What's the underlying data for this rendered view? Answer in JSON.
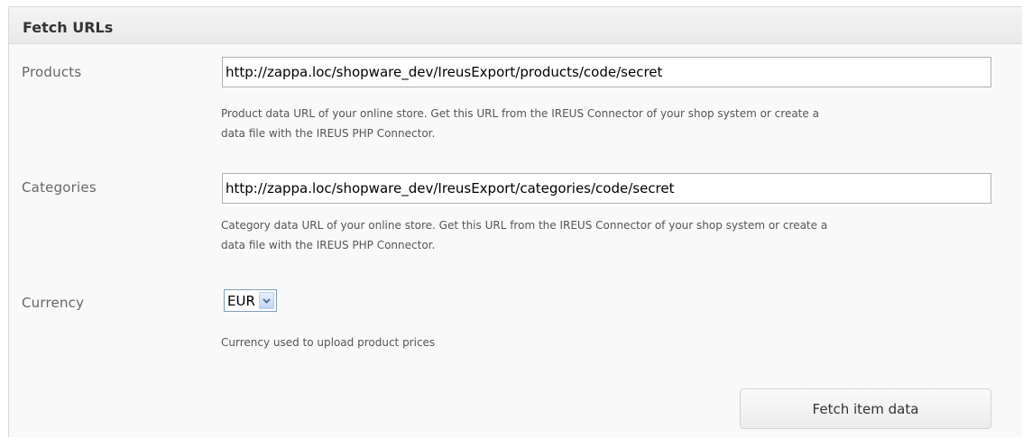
{
  "panel": {
    "title": "Fetch URLs"
  },
  "products": {
    "label": "Products",
    "value": "http://zappa.loc/shopware_dev/IreusExport/products/code/secret",
    "help_line1": "Product data URL of your online store. Get this URL from the IREUS Connector of your shop system or create a",
    "help_line2": "data file with the IREUS PHP Connector."
  },
  "categories": {
    "label": "Categories",
    "value": "http://zappa.loc/shopware_dev/IreusExport/categories/code/secret",
    "help_line1": "Category data URL of your online store. Get this URL from the IREUS Connector of your shop system or create a",
    "help_line2": "data file with the IREUS PHP Connector."
  },
  "currency": {
    "label": "Currency",
    "selected": "EUR",
    "help": "Currency used to upload product prices",
    "arrow_icon": "chevron-down-icon"
  },
  "actions": {
    "fetch_label": "Fetch item data"
  }
}
